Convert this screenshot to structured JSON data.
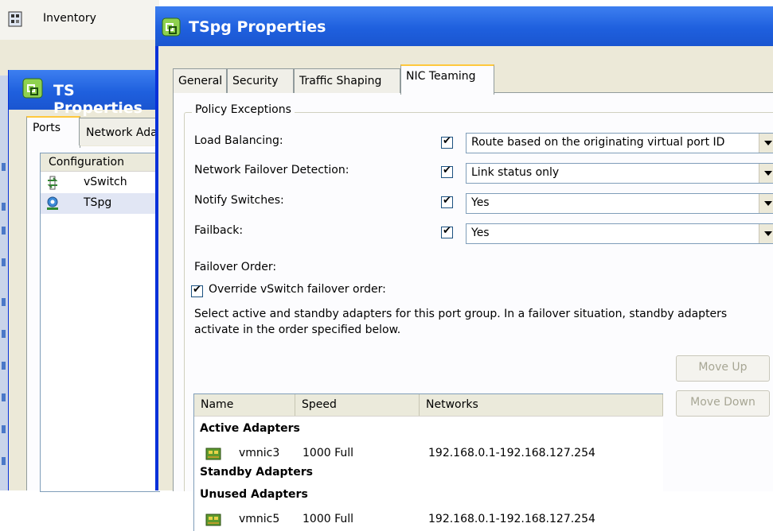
{
  "background": {
    "inventory_label": "Inventory"
  },
  "ts_window": {
    "title": "TS Properties",
    "tabs": [
      "Ports",
      "Network Adapters"
    ],
    "list_header": "Configuration",
    "items": [
      {
        "label": "vSwitch",
        "icon": "vswitch-icon"
      },
      {
        "label": "TSpg",
        "icon": "portgroup-icon"
      }
    ]
  },
  "dialog": {
    "title": "TSpg Properties",
    "tabs": [
      "General",
      "Security",
      "Traffic Shaping",
      "NIC Teaming"
    ],
    "active_tab": "NIC Teaming",
    "policy_exceptions": {
      "legend": "Policy Exceptions",
      "rows": [
        {
          "label": "Load Balancing:",
          "override": true,
          "value": "Route based on the originating virtual port ID"
        },
        {
          "label": "Network Failover Detection:",
          "override": true,
          "value": "Link status only"
        },
        {
          "label": "Notify Switches:",
          "override": true,
          "value": "Yes"
        },
        {
          "label": "Failback:",
          "override": true,
          "value": "Yes"
        }
      ],
      "failover_order_label": "Failover Order:",
      "override_failover_label": "Override vSwitch failover order:",
      "override_failover_checked": true,
      "description": "Select active and standby adapters for this port group.  In a failover situation, standby adapters activate  in the order specified below."
    },
    "adapters": {
      "columns": [
        "Name",
        "Speed",
        "Networks"
      ],
      "groups": [
        {
          "title": "Active Adapters",
          "rows": [
            {
              "name": "vmnic3",
              "speed": "1000 Full",
              "networks": "192.168.0.1-192.168.127.254"
            }
          ]
        },
        {
          "title": "Standby Adapters",
          "rows": []
        },
        {
          "title": "Unused Adapters",
          "rows": [
            {
              "name": "vmnic5",
              "speed": "1000 Full",
              "networks": "192.168.0.1-192.168.127.254"
            }
          ]
        }
      ]
    },
    "buttons": {
      "move_up": "Move Up",
      "move_down": "Move Down"
    }
  },
  "colors": {
    "title_bar": "#1f60de",
    "dialog_face": "#ece9d8",
    "tab_highlight": "#ffc83c"
  }
}
